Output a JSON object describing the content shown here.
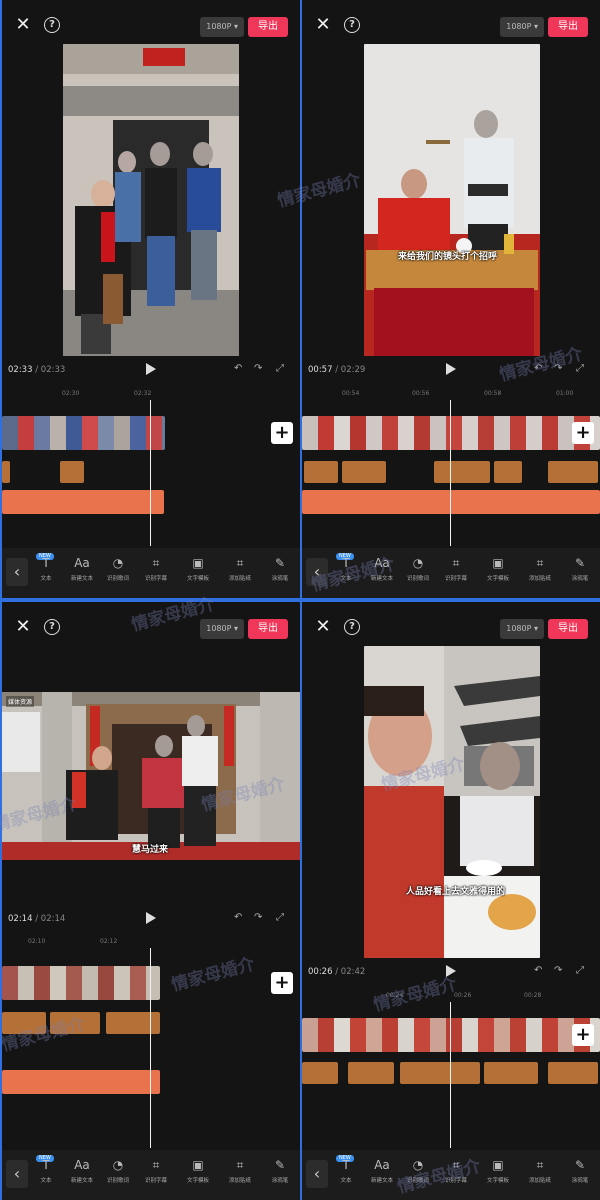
{
  "panels": [
    {
      "resolution": "1080P",
      "export_label": "导出",
      "time_current": "02:33",
      "time_total": "02:33",
      "ruler": [
        "02:30",
        "02:32"
      ],
      "toolbar": [
        "文本",
        "新建文本",
        "识别歌词",
        "识别字幕",
        "文字模板",
        "添加贴纸",
        "涂鸦笔"
      ],
      "new_badge": "NEW"
    },
    {
      "resolution": "1080P",
      "export_label": "导出",
      "time_current": "00:57",
      "time_total": "02:29",
      "ruler": [
        "00:54",
        "00:56",
        "00:58",
        "01:00"
      ],
      "subtitle": "来给我们的镜头打个招呼",
      "toolbar": [
        "文本",
        "新建文本",
        "识别歌词",
        "识别字幕",
        "文字模板",
        "添加贴纸",
        "涂鸦笔"
      ],
      "new_badge": "NEW"
    },
    {
      "resolution": "1080P",
      "export_label": "导出",
      "time_current": "02:14",
      "time_total": "02:14",
      "ruler": [
        "02:10",
        "02:12"
      ],
      "subtitle": "慧马过来",
      "corner_tag": "媒体资源",
      "toolbar": [
        "文本",
        "新建文本",
        "识别歌词",
        "识别字幕",
        "文字模板",
        "添加贴纸",
        "涂鸦笔"
      ],
      "new_badge": "NEW"
    },
    {
      "resolution": "1080P",
      "export_label": "导出",
      "time_current": "00:26",
      "time_total": "02:42",
      "ruler": [
        "00:24",
        "00:26",
        "00:28"
      ],
      "subtitle": "人品好看上去文雅得用的",
      "toolbar": [
        "文本",
        "新建文本",
        "识别歌词",
        "识别字幕",
        "文字模板",
        "添加贴纸",
        "涂鸦笔"
      ],
      "new_badge": "NEW"
    }
  ],
  "watermark": "情家母婚介",
  "icons": [
    "close-icon",
    "help-icon",
    "play-icon",
    "undo-icon",
    "redo-icon",
    "fullscreen-icon",
    "plus-icon",
    "back-chevron-icon"
  ],
  "colors": {
    "export": "#f0375a",
    "audio_track": "#e8734d",
    "subtitle_clip": "#c57a3a",
    "divider": "#2f6fe0"
  }
}
